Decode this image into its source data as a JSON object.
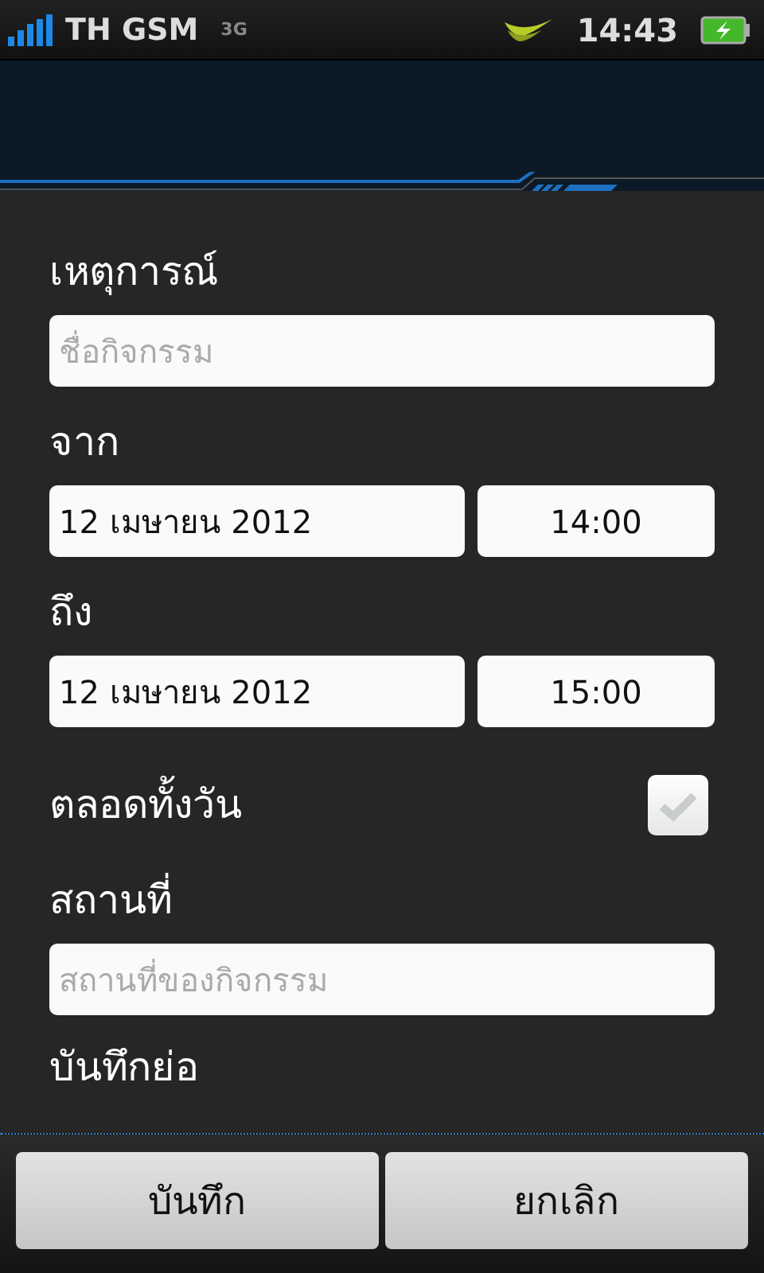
{
  "status_bar": {
    "carrier": "TH GSM",
    "network": "3G",
    "time": "14:43"
  },
  "form": {
    "title_label": "เหตุการณ์",
    "title_field": {
      "placeholder": "ชื่อกิจกรรม"
    },
    "from_label": "จาก",
    "from_date": "12 เมษายน 2012",
    "from_time": "14:00",
    "to_label": "ถึง",
    "to_date": "12 เมษายน 2012",
    "to_time": "15:00",
    "all_day": {
      "label": "ตลอดทั้งวัน",
      "checked": false
    },
    "location_label": "สถานที่",
    "location_field": {
      "placeholder": "สถานที่ของกิจกรรม"
    },
    "notes_label": "บันทึกย่อ"
  },
  "buttons": [
    "บันทึก",
    "ยกเลิก"
  ]
}
